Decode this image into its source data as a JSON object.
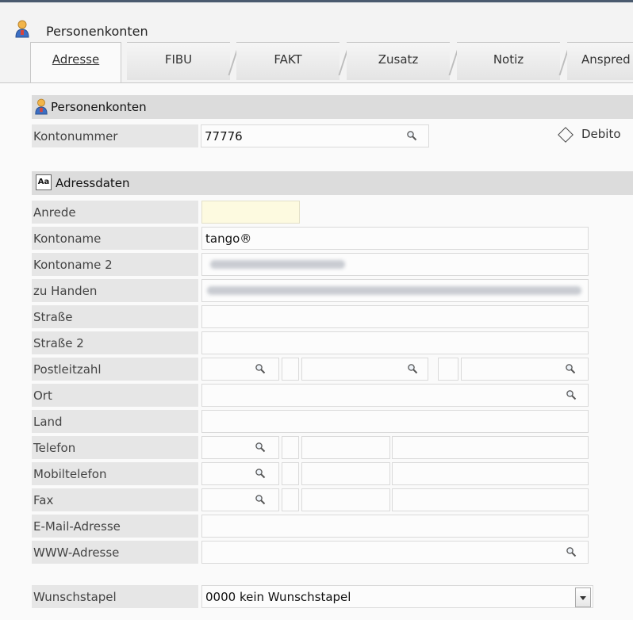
{
  "window": {
    "title": "Personenkonten"
  },
  "tabs": [
    "Adresse",
    "FIBU",
    "FAKT",
    "Zusatz",
    "Notiz",
    "Anspred"
  ],
  "section_personenkonten": {
    "title": "Personenkonten",
    "kontonummer_label": "Kontonummer",
    "kontonummer_value": "77776",
    "debit_label": "Debito"
  },
  "section_adressdaten": {
    "title": "Adressdaten",
    "icon_text": "Aa",
    "rows": [
      {
        "label": "Anrede",
        "value": ""
      },
      {
        "label": "Kontoname",
        "value": "tango®"
      },
      {
        "label": "Kontoname 2",
        "value": ""
      },
      {
        "label": "zu Handen",
        "value": ""
      },
      {
        "label": "Straße",
        "value": ""
      },
      {
        "label": "Straße 2",
        "value": ""
      },
      {
        "label": "Postleitzahl",
        "value": ""
      },
      {
        "label": "Ort",
        "value": ""
      },
      {
        "label": "Land",
        "value": ""
      },
      {
        "label": "Telefon",
        "value": ""
      },
      {
        "label": "Mobiltelefon",
        "value": ""
      },
      {
        "label": "Fax",
        "value": ""
      },
      {
        "label": "E-Mail-Adresse",
        "value": ""
      },
      {
        "label": "WWW-Adresse",
        "value": ""
      }
    ]
  },
  "wunschstapel": {
    "label": "Wunschstapel",
    "value": "0000 kein Wunschstapel"
  },
  "icons": [
    "person-icon",
    "search-icon",
    "diamond-icon",
    "text-icon",
    "chevron-down-icon"
  ],
  "colors": {
    "header_bg": "#dcdcdc",
    "label_bg": "#e6e6e6",
    "anrede_field_bg": "#fdfae0"
  }
}
